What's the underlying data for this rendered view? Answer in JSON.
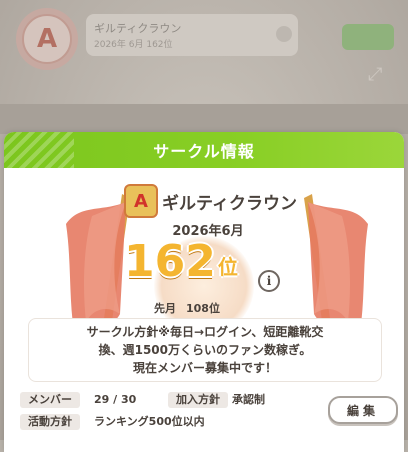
{
  "background": {
    "circle_name": "ギルティクラウン",
    "subtitle": "2026年 6月 162位",
    "emblem_letter": "A"
  },
  "dialog": {
    "title": "サークル情報",
    "circle_name": "ギルティクラウン",
    "emblem_letter": "A",
    "month": "2026年6月",
    "rank_value": "162",
    "rank_unit": "位",
    "info_icon": "i",
    "prev_label": "先月",
    "prev_value": "108位",
    "policy_lines": [
      "サークル方針※毎日→ログイン、短距離靴交",
      "換、週1500万くらいのファン数稼ぎ。",
      "現在メンバー募集中です！"
    ],
    "members_label": "メンバー",
    "members_value": "29 / 30",
    "join_label": "加入方針",
    "join_value": "承認制",
    "activity_label": "活動方針",
    "activity_value": "ランキング500位以内",
    "edit_button": "編集"
  },
  "colors": {
    "header_green": "#84cb22",
    "rank_gold": "#f4b530",
    "flag_red": "#e36a52"
  }
}
